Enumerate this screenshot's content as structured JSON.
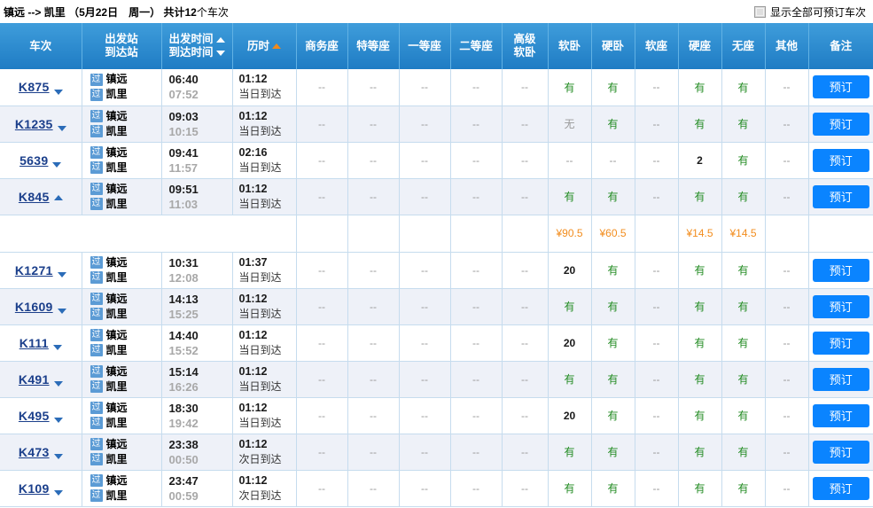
{
  "header": {
    "from": "镇远",
    "arrow": "-->",
    "to": "凯里",
    "date": "（5月22日　周一）",
    "count_prefix": "共计",
    "count": "12",
    "count_suffix": "个车次",
    "show_all_label": "显示全部可预订车次",
    "show_all_checked": false
  },
  "columns": [
    {
      "label": "车次",
      "line2": ""
    },
    {
      "label": "出发站",
      "line2": "到达站"
    },
    {
      "label": "出发时间",
      "line2": "到达时间"
    },
    {
      "label": "历时",
      "line2": ""
    },
    {
      "label": "商务座",
      "line2": ""
    },
    {
      "label": "特等座",
      "line2": ""
    },
    {
      "label": "一等座",
      "line2": ""
    },
    {
      "label": "二等座",
      "line2": ""
    },
    {
      "label": "高级",
      "line2": "软卧"
    },
    {
      "label": "软卧",
      "line2": ""
    },
    {
      "label": "硬卧",
      "line2": ""
    },
    {
      "label": "软座",
      "line2": ""
    },
    {
      "label": "硬座",
      "line2": ""
    },
    {
      "label": "无座",
      "line2": ""
    },
    {
      "label": "其他",
      "line2": ""
    },
    {
      "label": "备注",
      "line2": ""
    }
  ],
  "sort": {
    "depart_dir": "up",
    "arrive_dir": "down",
    "duration_dir": "up",
    "duration_active_color": "#f08a1c"
  },
  "book_label": "预订",
  "pass_badge": "过",
  "rows": [
    {
      "train": "K875",
      "caret": "down",
      "from": "镇远",
      "to": "凯里",
      "depart": "06:40",
      "arrive": "07:52",
      "duration": "01:12",
      "arrive_day": "当日到达",
      "seats": [
        "--",
        "--",
        "--",
        "--",
        "--",
        "有",
        "有",
        "--",
        "有",
        "有",
        "--"
      ],
      "book": "预订"
    },
    {
      "train": "K1235",
      "caret": "down",
      "from": "镇远",
      "to": "凯里",
      "depart": "09:03",
      "arrive": "10:15",
      "duration": "01:12",
      "arrive_day": "当日到达",
      "seats": [
        "--",
        "--",
        "--",
        "--",
        "--",
        "无",
        "有",
        "--",
        "有",
        "有",
        "--"
      ],
      "book": "预订"
    },
    {
      "train": "5639",
      "caret": "down",
      "from": "镇远",
      "to": "凯里",
      "depart": "09:41",
      "arrive": "11:57",
      "duration": "02:16",
      "arrive_day": "当日到达",
      "seats": [
        "--",
        "--",
        "--",
        "--",
        "--",
        "--",
        "--",
        "--",
        "2",
        "有",
        "--"
      ],
      "book": "预订"
    },
    {
      "train": "K845",
      "caret": "up",
      "from": "镇远",
      "to": "凯里",
      "depart": "09:51",
      "arrive": "11:03",
      "duration": "01:12",
      "arrive_day": "当日到达",
      "seats": [
        "--",
        "--",
        "--",
        "--",
        "--",
        "有",
        "有",
        "--",
        "有",
        "有",
        "--"
      ],
      "book": "预订"
    },
    {
      "train": "K1271",
      "caret": "down",
      "from": "镇远",
      "to": "凯里",
      "depart": "10:31",
      "arrive": "12:08",
      "duration": "01:37",
      "arrive_day": "当日到达",
      "seats": [
        "--",
        "--",
        "--",
        "--",
        "--",
        "20",
        "有",
        "--",
        "有",
        "有",
        "--"
      ],
      "book": "预订"
    },
    {
      "train": "K1609",
      "caret": "down",
      "from": "镇远",
      "to": "凯里",
      "depart": "14:13",
      "arrive": "15:25",
      "duration": "01:12",
      "arrive_day": "当日到达",
      "seats": [
        "--",
        "--",
        "--",
        "--",
        "--",
        "有",
        "有",
        "--",
        "有",
        "有",
        "--"
      ],
      "book": "预订"
    },
    {
      "train": "K111",
      "caret": "down",
      "from": "镇远",
      "to": "凯里",
      "depart": "14:40",
      "arrive": "15:52",
      "duration": "01:12",
      "arrive_day": "当日到达",
      "seats": [
        "--",
        "--",
        "--",
        "--",
        "--",
        "20",
        "有",
        "--",
        "有",
        "有",
        "--"
      ],
      "book": "预订"
    },
    {
      "train": "K491",
      "caret": "down",
      "from": "镇远",
      "to": "凯里",
      "depart": "15:14",
      "arrive": "16:26",
      "duration": "01:12",
      "arrive_day": "当日到达",
      "seats": [
        "--",
        "--",
        "--",
        "--",
        "--",
        "有",
        "有",
        "--",
        "有",
        "有",
        "--"
      ],
      "book": "预订"
    },
    {
      "train": "K495",
      "caret": "down",
      "from": "镇远",
      "to": "凯里",
      "depart": "18:30",
      "arrive": "19:42",
      "duration": "01:12",
      "arrive_day": "当日到达",
      "seats": [
        "--",
        "--",
        "--",
        "--",
        "--",
        "20",
        "有",
        "--",
        "有",
        "有",
        "--"
      ],
      "book": "预订"
    },
    {
      "train": "K473",
      "caret": "down",
      "from": "镇远",
      "to": "凯里",
      "depart": "23:38",
      "arrive": "00:50",
      "duration": "01:12",
      "arrive_day": "次日到达",
      "seats": [
        "--",
        "--",
        "--",
        "--",
        "--",
        "有",
        "有",
        "--",
        "有",
        "有",
        "--"
      ],
      "book": "预订"
    },
    {
      "train": "K109",
      "caret": "down",
      "from": "镇远",
      "to": "凯里",
      "depart": "23:47",
      "arrive": "00:59",
      "duration": "01:12",
      "arrive_day": "次日到达",
      "seats": [
        "--",
        "--",
        "--",
        "--",
        "--",
        "有",
        "有",
        "--",
        "有",
        "有",
        "--"
      ],
      "book": "预订"
    }
  ],
  "expanded_price_row": {
    "after_row_index": 3,
    "prices": [
      "",
      "",
      "",
      "",
      "",
      "¥90.5",
      "¥60.5",
      "",
      "¥14.5",
      "¥14.5",
      ""
    ]
  },
  "colors": {
    "header_blue": "#2f8dd0",
    "available_green": "#208a20",
    "price_orange": "#f28d1e",
    "book_button_blue": "#0a84ff",
    "train_link_blue": "#1b3f8b",
    "row_stripe": "#eef1f8"
  }
}
